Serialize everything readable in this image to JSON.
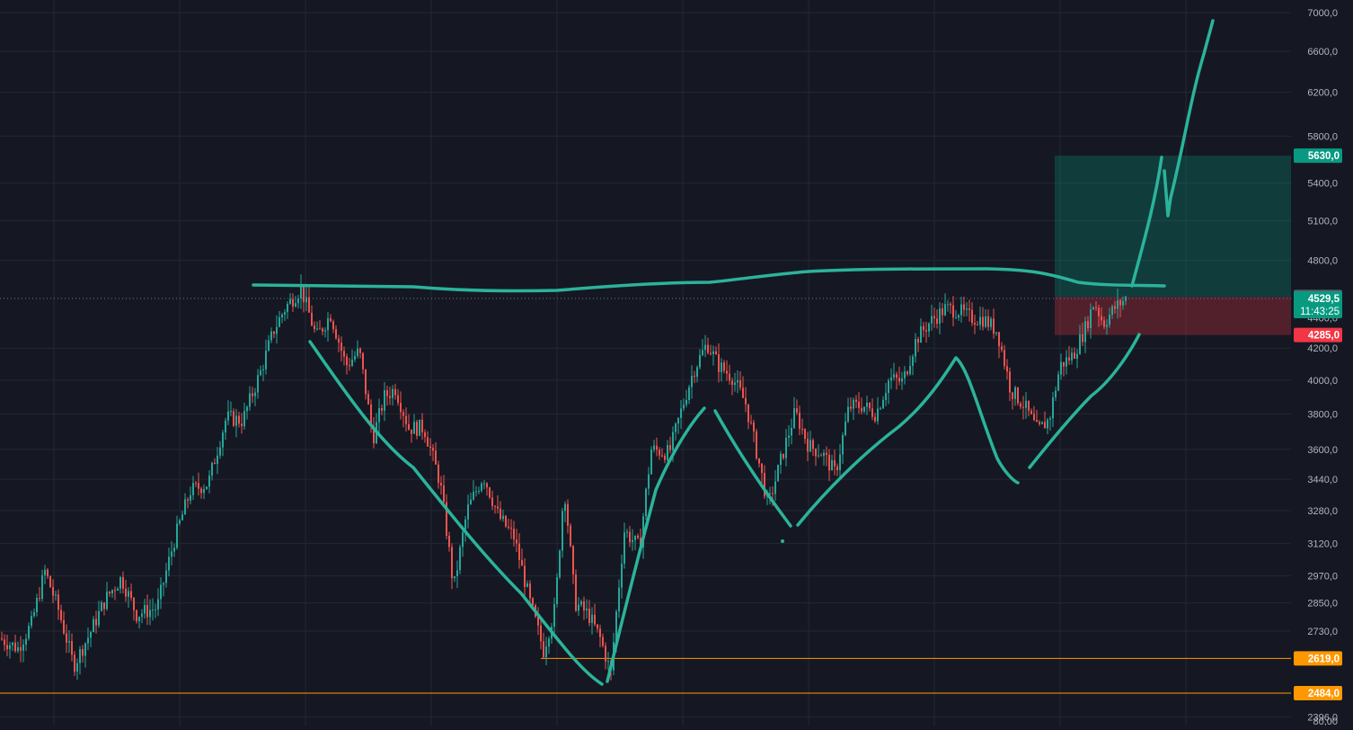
{
  "chart_data": {
    "type": "candlestick",
    "title": "",
    "xlabel": "",
    "ylabel": "",
    "scale": "log",
    "grid": true,
    "y_ticks": [
      "7000,0",
      "6600,0",
      "6200,0",
      "5800,0",
      "5400,0",
      "5100,0",
      "4800,0",
      "4200,0",
      "4000,0",
      "3800,0",
      "3600,0",
      "3440,0",
      "3280,0",
      "3120,0",
      "2970,0",
      "2850,0",
      "2730,0",
      "2396,0",
      "80,00"
    ],
    "y_tick_values": [
      7000,
      6600,
      6200,
      5800,
      5400,
      5100,
      4800,
      4200,
      4000,
      3800,
      3600,
      3440,
      3280,
      3120,
      2970,
      2850,
      2730,
      2396,
      null
    ],
    "partially_hidden_ticks": [
      "4400,0",
      "2500,0"
    ],
    "price_labels": {
      "target": {
        "text": "5630,0",
        "value": 5630,
        "color": "#089981"
      },
      "entry": {
        "text": "4540,0",
        "value": 4540,
        "color": "#5d606b"
      },
      "last": {
        "text": "4529,5",
        "value": 4529.5,
        "countdown": "11:43:25",
        "color": "#089981"
      },
      "stop": {
        "text": "4285,0",
        "value": 4285,
        "color": "#f23645"
      },
      "support_1": {
        "text": "2619,0",
        "value": 2619,
        "color": "#ff9800"
      },
      "support_2": {
        "text": "2484,0",
        "value": 2484,
        "color": "#ff9800"
      }
    },
    "position_tool": {
      "type": "long",
      "entry": 4540,
      "target": 5630,
      "stop": 4285
    },
    "horizontal_lines": [
      {
        "value": 2619,
        "color": "#ff9800"
      },
      {
        "value": 2484,
        "color": "#ff9800"
      }
    ],
    "price_path": [
      [
        0,
        2700
      ],
      [
        20,
        2660
      ],
      [
        35,
        2760
      ],
      [
        50,
        2990
      ],
      [
        65,
        2820
      ],
      [
        82,
        2590
      ],
      [
        100,
        2720
      ],
      [
        118,
        2870
      ],
      [
        135,
        2960
      ],
      [
        152,
        2800
      ],
      [
        175,
        2830
      ],
      [
        195,
        3150
      ],
      [
        212,
        3380
      ],
      [
        232,
        3420
      ],
      [
        252,
        3780
      ],
      [
        270,
        3760
      ],
      [
        290,
        4050
      ],
      [
        305,
        4320
      ],
      [
        318,
        4470
      ],
      [
        335,
        4600
      ],
      [
        352,
        4270
      ],
      [
        368,
        4420
      ],
      [
        385,
        4090
      ],
      [
        400,
        4180
      ],
      [
        415,
        3660
      ],
      [
        428,
        3900
      ],
      [
        440,
        3950
      ],
      [
        455,
        3720
      ],
      [
        472,
        3720
      ],
      [
        490,
        3420
      ],
      [
        505,
        2910
      ],
      [
        520,
        3280
      ],
      [
        538,
        3460
      ],
      [
        555,
        3250
      ],
      [
        572,
        3150
      ],
      [
        590,
        2850
      ],
      [
        605,
        2650
      ],
      [
        618,
        2830
      ],
      [
        628,
        3400
      ],
      [
        640,
        2850
      ],
      [
        655,
        2800
      ],
      [
        668,
        2700
      ],
      [
        680,
        2560
      ],
      [
        695,
        3180
      ],
      [
        712,
        3100
      ],
      [
        725,
        3600
      ],
      [
        745,
        3580
      ],
      [
        760,
        3850
      ],
      [
        772,
        4060
      ],
      [
        787,
        4230
      ],
      [
        800,
        4090
      ],
      [
        815,
        4020
      ],
      [
        830,
        3860
      ],
      [
        842,
        3590
      ],
      [
        855,
        3300
      ],
      [
        868,
        3520
      ],
      [
        885,
        3810
      ],
      [
        900,
        3620
      ],
      [
        915,
        3580
      ],
      [
        930,
        3470
      ],
      [
        945,
        3840
      ],
      [
        960,
        3850
      ],
      [
        975,
        3800
      ],
      [
        990,
        4010
      ],
      [
        1005,
        3990
      ],
      [
        1020,
        4260
      ],
      [
        1035,
        4370
      ],
      [
        1052,
        4460
      ],
      [
        1066,
        4450
      ],
      [
        1080,
        4400
      ],
      [
        1095,
        4390
      ],
      [
        1110,
        4310
      ],
      [
        1125,
        3940
      ],
      [
        1140,
        3850
      ],
      [
        1155,
        3700
      ],
      [
        1168,
        3770
      ],
      [
        1180,
        4090
      ],
      [
        1195,
        4160
      ],
      [
        1208,
        4330
      ],
      [
        1218,
        4510
      ],
      [
        1228,
        4360
      ],
      [
        1240,
        4460
      ],
      [
        1253,
        4529.5
      ]
    ],
    "annotations": [
      {
        "type": "freehand",
        "color": "#26a69a",
        "label": ""
      }
    ]
  },
  "colors": {
    "background": "#151822",
    "grid": "#232735",
    "up": "#26a69a",
    "down": "#ef5350",
    "drawing": "#2bb39b",
    "axis_text": "#b2b5be"
  }
}
